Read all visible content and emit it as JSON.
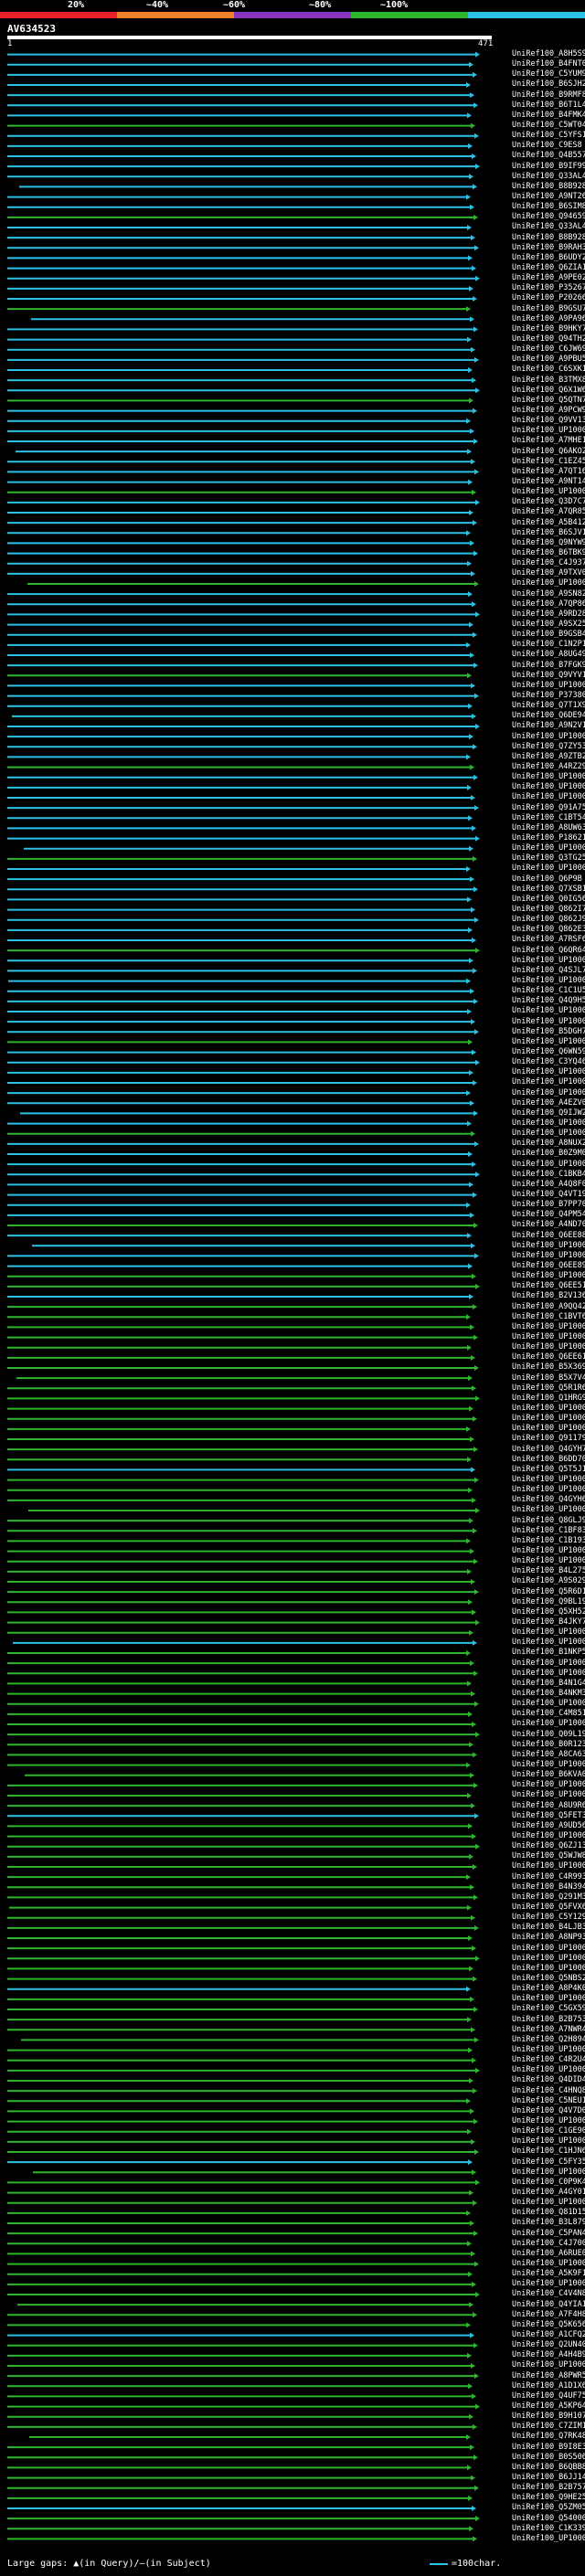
{
  "scale": {
    "labels": [
      "20%",
      "~40%",
      "~60%",
      "~80%",
      "~100%"
    ],
    "colors": [
      "#e8202a",
      "#f0802a",
      "#8a35c2",
      "#2db52d",
      "#2bc0e4"
    ]
  },
  "query": {
    "title": "AV634523",
    "start": "1",
    "end": "471"
  },
  "hits": [
    "UniRef100_A8H5S9",
    "UniRef100_B4FNT0",
    "UniRef100_C5YUM9",
    "UniRef100_B6SJH2",
    "UniRef100_B9RMF8",
    "UniRef100_B6T1L4",
    "UniRef100_B4FMK4",
    "UniRef100_C5WT04",
    "UniRef100_C5YFS1",
    "UniRef100_C9ES8",
    "UniRef100_Q4B557",
    "UniRef100_B9IF99",
    "UniRef100_Q33AL4",
    "UniRef100_B8B928",
    "UniRef100_A9NT26",
    "UniRef100_B6SIM8",
    "UniRef100_Q94659",
    "UniRef100_Q33AL4",
    "UniRef100_B8B928",
    "UniRef100_B9RAH3",
    "UniRef100_B6UDY2",
    "UniRef100_Q6ZIA1",
    "UniRef100_A9PE02",
    "UniRef100_P35267",
    "UniRef100_P20266",
    "UniRef100_B9GSU7",
    "UniRef100_A9PA96",
    "UniRef100_B9HKY7",
    "UniRef100_Q94TH2",
    "UniRef100_C6JW69",
    "UniRef100_A9PBU5",
    "UniRef100_C6SXK1",
    "UniRef100_B3TMX8",
    "UniRef100_Q6X1W6",
    "UniRef100_Q5QTN7",
    "UniRef100_A9PCW9",
    "UniRef100_Q9VV13",
    "UniRef100_UP1000...",
    "UniRef100_A7MHE1",
    "UniRef100_Q6AKO2",
    "UniRef100_C1EZ45",
    "UniRef100_A7QT16",
    "UniRef100_A9NT14",
    "UniRef100_UP1000...",
    "UniRef100_Q3D7C7",
    "UniRef100_A7QR85",
    "UniRef100_A5B412",
    "UniRef100_B6SJV1",
    "UniRef100_Q9NYW9",
    "UniRef100_B6TBK9",
    "UniRef100_C4J937",
    "UniRef100_A9TXV0",
    "UniRef100_UP1000...",
    "UniRef100_A9SN82",
    "UniRef100_A7QP86",
    "UniRef100_A9RD28",
    "UniRef100_A9SX25",
    "UniRef100_B9GSB4",
    "UniRef100_C1N2P1",
    "UniRef100_A8UG49",
    "UniRef100_B7FGK9",
    "UniRef100_Q9VYV1",
    "UniRef100_UP1000...",
    "UniRef100_P37380",
    "UniRef100_Q7T1X9",
    "UniRef100_Q6DE94",
    "UniRef100_A9N2V1",
    "UniRef100_UP1000...",
    "UniRef100_Q7ZY53",
    "UniRef100_A9ZTB2",
    "UniRef100_A4RZ29",
    "UniRef100_UP1000...",
    "UniRef100_UP1000...",
    "UniRef100_UP1000...",
    "UniRef100_Q91A75",
    "UniRef100_C1BT54",
    "UniRef100_A8UW63",
    "UniRef100_P18621",
    "UniRef100_UP1000...",
    "UniRef100_Q3TG25",
    "UniRef100_UP1000...",
    "UniRef100_Q6P9B",
    "UniRef100_Q7XSB1",
    "UniRef100_Q0IG56",
    "UniRef100_Q862I7",
    "UniRef100_Q862J9",
    "UniRef100_Q862E3",
    "UniRef100_A7RSF6",
    "UniRef100_Q6QR64",
    "UniRef100_UP1000...",
    "UniRef100_Q4SJL7",
    "UniRef100_UP1000...",
    "UniRef100_C1C1U5",
    "UniRef100_Q4Q9H5",
    "UniRef100_UP1000...",
    "UniRef100_UP1000...",
    "UniRef100_B5DGH7",
    "UniRef100_UP1000...",
    "UniRef100_Q6WN59",
    "UniRef100_C3YQ46",
    "UniRef100_UP1000...",
    "UniRef100_UP1000...",
    "UniRef100_UP1000...",
    "UniRef100_A4EZV0",
    "UniRef100_Q9IJW2",
    "UniRef100_UP1000...",
    "UniRef100_UP1000...",
    "UniRef100_A8NUX2",
    "UniRef100_B0Z9M0",
    "UniRef100_UP1000...",
    "UniRef100_C1BKB4",
    "UniRef100_A4Q8F0",
    "UniRef100_Q4VT19",
    "UniRef100_B7PP70",
    "UniRef100_Q4PM54",
    "UniRef100_A4ND70",
    "UniRef100_Q6EE88",
    "UniRef100_UP1000...",
    "UniRef100_UP1000...",
    "UniRef100_Q6EE89",
    "UniRef100_UP1000...",
    "UniRef100_Q6EE51",
    "UniRef100_B2V136",
    "UniRef100_A9QQ42",
    "UniRef100_C1BVT6",
    "UniRef100_UP1000...",
    "UniRef100_UP1000...",
    "UniRef100_UP1000...",
    "UniRef100_Q6EE61",
    "UniRef100_B5X369",
    "UniRef100_B5X7V4",
    "UniRef100_Q5R1R6",
    "UniRef100_Q1HRG9",
    "UniRef100_UP1000...",
    "UniRef100_UP1000...",
    "UniRef100_UP1000...",
    "UniRef100_Q91179",
    "UniRef100_Q4GYH7",
    "UniRef100_B6DD70",
    "UniRef100_Q5T5J1",
    "UniRef100_UP1000...",
    "UniRef100_UP1000...",
    "UniRef100_Q4GYH6",
    "UniRef100_UP1000...",
    "UniRef100_Q8GLJ9",
    "UniRef100_C1BF83",
    "UniRef100_C1B193",
    "UniRef100_UP1000...",
    "UniRef100_UP1000...",
    "UniRef100_B4L275",
    "UniRef100_A9S029",
    "UniRef100_Q5R6D1",
    "UniRef100_Q9BL19",
    "UniRef100_Q5XH52",
    "UniRef100_B4JKY7",
    "UniRef100_UP1000...",
    "UniRef100_UP1000...",
    "UniRef100_B1NKP5",
    "UniRef100_UP1000...",
    "UniRef100_UP1000...",
    "UniRef100_B4N1G4",
    "UniRef100_B4NKM3",
    "UniRef100_UP1000...",
    "UniRef100_C4M851",
    "UniRef100_UP1000...",
    "UniRef100_Q09L19",
    "UniRef100_B0R123",
    "UniRef100_A8CA63",
    "UniRef100_UP1000...",
    "UniRef100_B6KVA0",
    "UniRef100_UP1000...",
    "UniRef100_UP1000...",
    "UniRef100_A8U9R6",
    "UniRef100_Q5FET3",
    "UniRef100_A9UD56",
    "UniRef100_UP1000...",
    "UniRef100_Q6ZJ13",
    "UniRef100_Q5WJW8",
    "UniRef100_UP1000...",
    "UniRef100_C4R993",
    "UniRef100_B4N394",
    "UniRef100_Q291M3",
    "UniRef100_Q5FVX6",
    "UniRef100_C5Y129",
    "UniRef100_B4LJB3",
    "UniRef100_A8NP93",
    "UniRef100_UP1000...",
    "UniRef100_UP1000...",
    "UniRef100_UP1000...",
    "UniRef100_Q5NBS2",
    "UniRef100_A8P4K0",
    "UniRef100_UP1000...",
    "UniRef100_C5GX59",
    "UniRef100_B2B753",
    "UniRef100_A7NWR4",
    "UniRef100_Q2H894",
    "UniRef100_UP1000...",
    "UniRef100_C4R2U4",
    "UniRef100_UP1000...",
    "UniRef100_Q4DID4",
    "UniRef100_C4HNQ8",
    "UniRef100_C5NEU1",
    "UniRef100_Q4V7D0",
    "UniRef100_UP1000...",
    "UniRef100_C1GE90",
    "UniRef100_UP1000...",
    "UniRef100_C1HJN6",
    "UniRef100_C5FY35",
    "UniRef100_UP1000...",
    "UniRef100_C0P9K4",
    "UniRef100_A4GY01",
    "UniRef100_UP1000...",
    "UniRef100_Q81D15",
    "UniRef100_B3L879",
    "UniRef100_C5PAN4",
    "UniRef100_C4J700",
    "UniRef100_A6RUE0",
    "UniRef100_UP1000...",
    "UniRef100_A5K9F1",
    "UniRef100_UP1000...",
    "UniRef100_C4V4N8",
    "UniRef100_Q4YIA1",
    "UniRef100_A7F4H8",
    "UniRef100_Q5K656",
    "UniRef100_A1CFQ2",
    "UniRef100_Q2UN40",
    "UniRef100_A4H4B9",
    "UniRef100_UP1000...",
    "UniRef100_A8PWR5",
    "UniRef100_A1D1X6",
    "UniRef100_Q4UF75",
    "UniRef100_A5KP64",
    "UniRef100_B9H107",
    "UniRef100_C7ZIM1",
    "UniRef100_Q7RK48",
    "UniRef100_B9I8E3",
    "UniRef100_B0S506",
    "UniRef100_B6QBB8",
    "UniRef100_B6JJ14",
    "UniRef100_B2B757",
    "UniRef100_Q9HE25",
    "UniRef100_Q5ZM05",
    "UniRef100_Q54000",
    "UniRef100_C1K339",
    "UniRef100_UP1000..."
  ],
  "footer": {
    "gaps_label": "Large gaps: ▲(in Query)/–(in Subject)",
    "scale_label": "=100char."
  }
}
